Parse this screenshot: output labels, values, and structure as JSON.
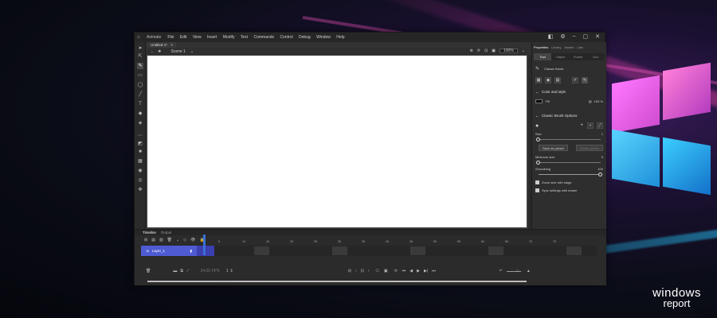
{
  "app": {
    "workspace": "Animate",
    "menu": [
      "File",
      "Edit",
      "View",
      "Insert",
      "Modify",
      "Text",
      "Commands",
      "Control",
      "Debug",
      "Window",
      "Help"
    ]
  },
  "document": {
    "tab_label": "Untitled-1*",
    "close": "×",
    "scene": "Scene 1",
    "zoom": "100%"
  },
  "properties": {
    "panel_tabs": [
      "Properties",
      "Library",
      "Assets",
      "Libs"
    ],
    "sub_tabs": [
      "Tool",
      "Object",
      "Frame",
      "Doc"
    ],
    "tool_name": "Classic Brush",
    "color_section": "Color and style",
    "fill_label": "Fill",
    "fill_color": "#000000",
    "fill_alpha": "100 %",
    "brush_section": "Classic Brush Options",
    "size_label": "Size",
    "size_value": "1",
    "save_preset": "Save as preset",
    "delete_preset": "Delete preset",
    "min_size_label": "Minimum size",
    "min_size_value": "0",
    "smoothing_label": "Smoothing",
    "smoothing_value": "100",
    "check1": "Zoom size with stage",
    "check2": "Sync settings with eraser"
  },
  "timeline": {
    "tabs": [
      "Timeline",
      "Output"
    ],
    "layer_name": "Layer_1",
    "frame_numbers": [
      "1",
      "5",
      "10",
      "15",
      "20",
      "25",
      "30",
      "35",
      "40",
      "45",
      "50",
      "55",
      "60",
      "65",
      "70",
      "75"
    ],
    "fps": "24.00",
    "fps_unit": "FPS",
    "frame_counter": "1"
  },
  "brand": {
    "line1": "windows",
    "line2": "report"
  }
}
